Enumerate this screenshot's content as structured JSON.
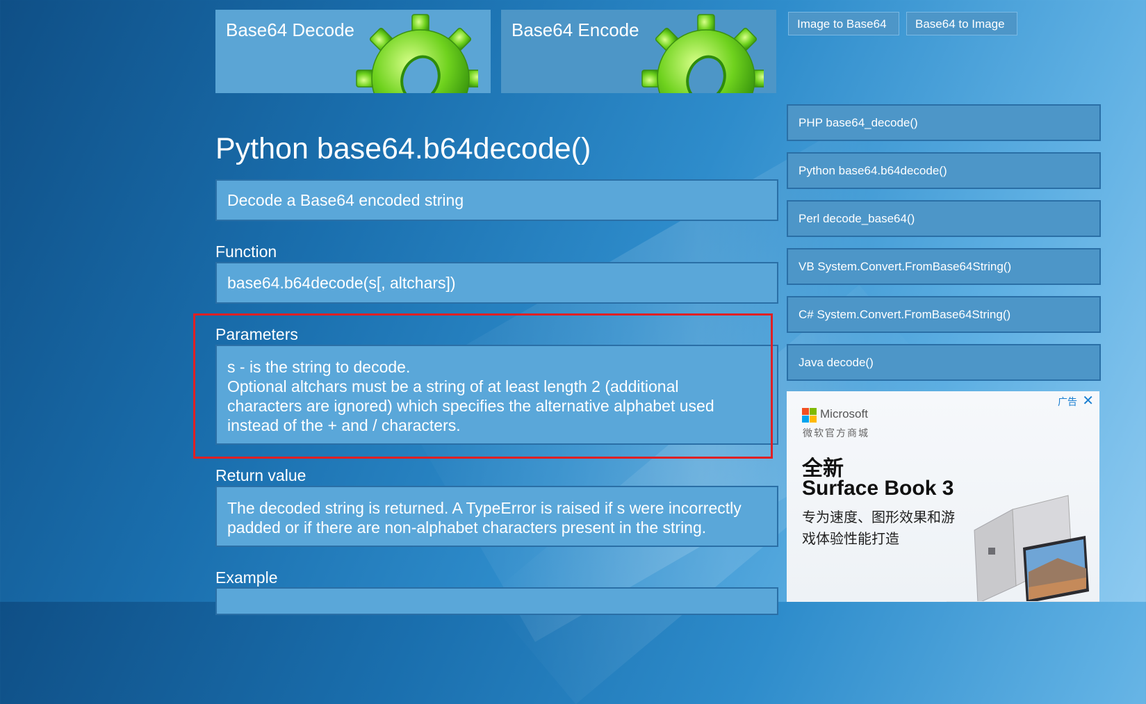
{
  "tiles": {
    "decode_label": "Base64 Decode",
    "encode_label": "Base64 Encode"
  },
  "top_buttons": {
    "image_to_base64": "Image to Base64",
    "base64_to_image": "Base64 to Image"
  },
  "main": {
    "title": "Python base64.b64decode()",
    "description": "Decode a Base64 encoded string",
    "function_label": "Function",
    "function_value": "base64.b64decode(s[, altchars])",
    "parameters_label": "Parameters",
    "parameters_lines": [
      "s - is the string to decode.",
      "Optional altchars must be a string of at least length 2 (additional",
      "characters are ignored) which specifies the alternative alphabet used",
      "instead of the + and / characters."
    ],
    "return_label": "Return value",
    "return_lines": [
      "The decoded string is returned. A TypeError is raised if s were incorrectly",
      "padded or if there are non-alphabet characters present in the string."
    ],
    "example_label": "Example"
  },
  "sidebar": {
    "links": [
      "PHP base64_decode()",
      "Python base64.b64decode()",
      "Perl decode_base64()",
      "VB System.Convert.FromBase64String()",
      "C# System.Convert.FromBase64String()",
      "Java decode()"
    ]
  },
  "ad": {
    "tag": "广告",
    "close": "✕",
    "brand": "Microsoft",
    "store": "微软官方商城",
    "headline1": "全新",
    "headline2": "Surface Book 3",
    "tagline": "专为速度、图形效果和游戏体验性能打造"
  },
  "colors": {
    "highlight_border": "#e02024",
    "box_fill": "#5aa7d9",
    "box_border": "#2a6fa6",
    "gear_green": "#6fd21e"
  },
  "icons": {
    "tile_decode": "gear-icon",
    "tile_encode": "gear-icon",
    "ad_logo": "microsoft-logo"
  }
}
